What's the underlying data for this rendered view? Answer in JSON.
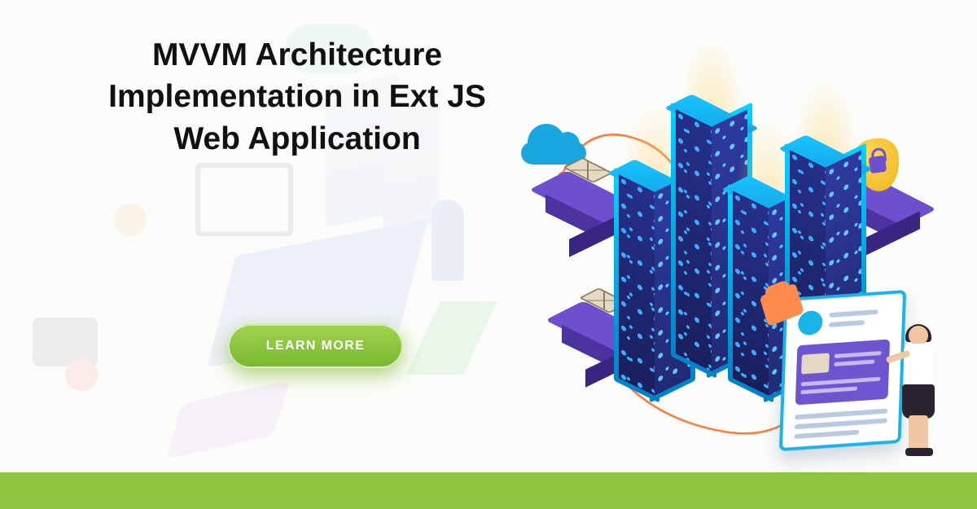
{
  "hero": {
    "title": "MVVM Architecture Implementation in Ext JS Web Application"
  },
  "cta": {
    "label": "LEARN MORE"
  },
  "colors": {
    "accent_green": "#8cc63f",
    "button_gradient_top": "#a0d24c",
    "button_gradient_bottom": "#78b82f",
    "cloud_blue": "#1aa7e0",
    "tower_frame": "#00d4ff",
    "pedestal_purple": "#6e4fce",
    "shield_gold": "#ffd75a"
  },
  "illustration": {
    "elements": [
      "cloud",
      "server-tower-1",
      "server-tower-2",
      "server-tower-3",
      "server-tower-4",
      "pedestal-envelope-left",
      "pedestal-envelope-bottom",
      "pedestal-shield-right",
      "security-shield",
      "document-profile-card",
      "clipboard",
      "woman-user"
    ]
  }
}
